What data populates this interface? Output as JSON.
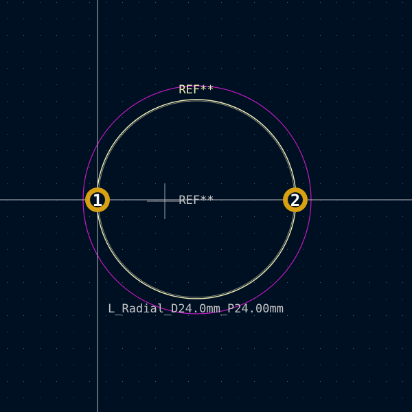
{
  "editor": {
    "view": "footprint-canvas",
    "colors": {
      "background": "#001023",
      "grid_dot": "#4a5a72",
      "crosshair": "#d8d8d8",
      "silkscreen": "#f2eeb8",
      "courtyard": "#c21ac2",
      "pad": "#d8a012",
      "pad_hole": "#001023",
      "pad_number": "#ffffff",
      "fab_text": "#c6c6c6",
      "ref_text_top": "#f2eeb8"
    }
  },
  "footprint": {
    "ref_silk": "REF**",
    "ref_fab": "REF**",
    "value": "L_Radial_D24.0mm_P24.00mm",
    "pads": [
      {
        "number": "1"
      },
      {
        "number": "2"
      }
    ]
  }
}
